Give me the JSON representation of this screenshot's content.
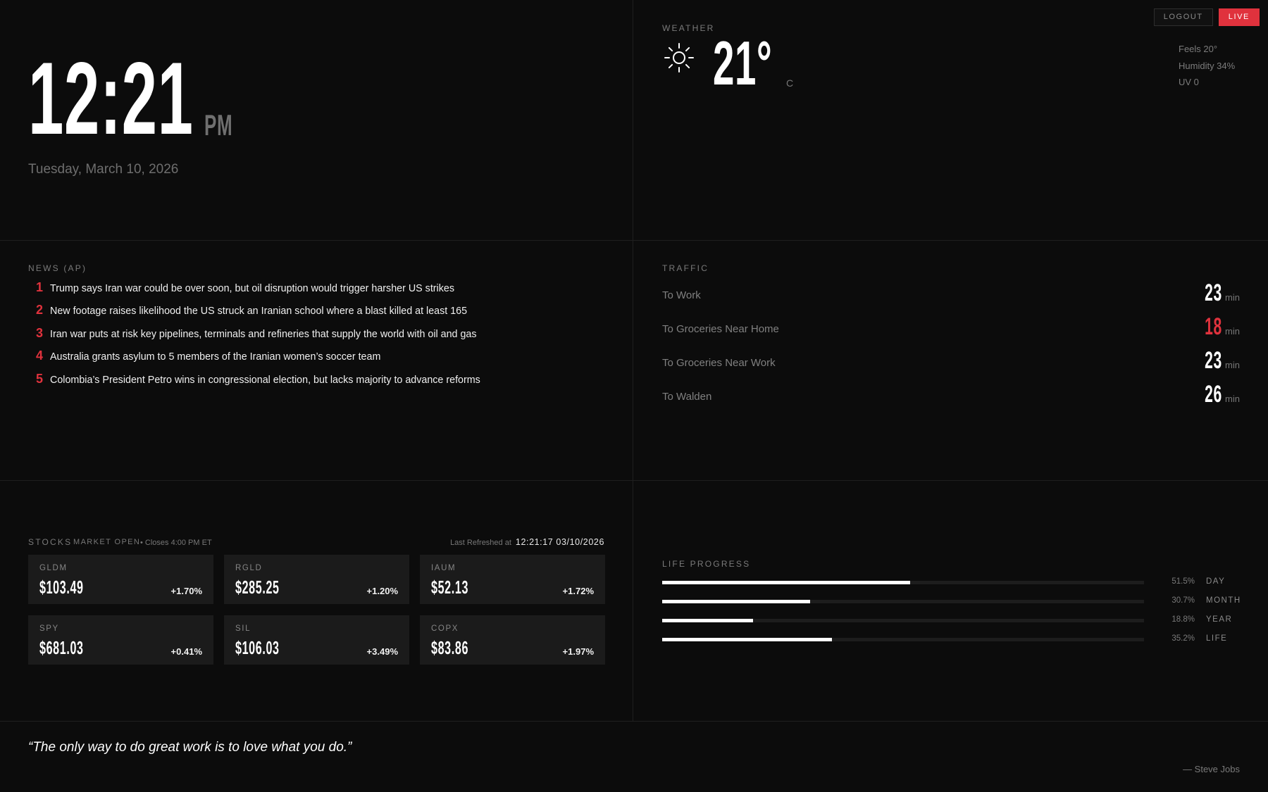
{
  "controls": {
    "logout_label": "LOGOUT",
    "live_label": "LIVE"
  },
  "clock": {
    "time": "12:21",
    "ampm": "PM",
    "date": "Tuesday, March 10, 2026"
  },
  "weather": {
    "label": "WEATHER",
    "icon": "sun-icon",
    "temp": "21°",
    "unit": "C",
    "feels": "Feels 20°",
    "humidity": "Humidity 34%",
    "uv": "UV 0"
  },
  "news": {
    "label": "NEWS (AP)",
    "items": [
      {
        "num": "1",
        "text": "Trump says Iran war could be over soon, but oil disruption would trigger harsher US strikes"
      },
      {
        "num": "2",
        "text": "New footage raises likelihood the US struck an Iranian school where a blast killed at least 165"
      },
      {
        "num": "3",
        "text": "Iran war puts at risk key pipelines, terminals and refineries that supply the world with oil and gas"
      },
      {
        "num": "4",
        "text": "Australia grants asylum to 5 members of the Iranian women’s soccer team"
      },
      {
        "num": "5",
        "text": "Colombia’s President Petro wins in congressional election, but lacks majority to advance reforms"
      }
    ]
  },
  "traffic": {
    "label": "TRAFFIC",
    "unit": "min",
    "routes": [
      {
        "name": "To Work",
        "minutes": "23",
        "alert": false
      },
      {
        "name": "To Groceries Near Home",
        "minutes": "18",
        "alert": true
      },
      {
        "name": "To Groceries Near Work",
        "minutes": "23",
        "alert": false
      },
      {
        "name": "To Walden",
        "minutes": "26",
        "alert": false
      }
    ]
  },
  "stocks": {
    "label": "STOCKS",
    "market_status": "MARKET OPEN",
    "closes": "• Closes 4:00 PM ET",
    "refreshed_label": "Last Refreshed at",
    "refreshed_value": "12:21:17 03/10/2026",
    "items": [
      {
        "symbol": "GLDM",
        "price": "$103.49",
        "change": "+1.70%"
      },
      {
        "symbol": "RGLD",
        "price": "$285.25",
        "change": "+1.20%"
      },
      {
        "symbol": "IAUM",
        "price": "$52.13",
        "change": "+1.72%"
      },
      {
        "symbol": "SPY",
        "price": "$681.03",
        "change": "+0.41%"
      },
      {
        "symbol": "SIL",
        "price": "$106.03",
        "change": "+3.49%"
      },
      {
        "symbol": "COPX",
        "price": "$83.86",
        "change": "+1.97%"
      }
    ]
  },
  "life_progress": {
    "label": "LIFE PROGRESS",
    "items": [
      {
        "name": "DAY",
        "percent": 51.5,
        "percent_label": "51.5%"
      },
      {
        "name": "MONTH",
        "percent": 30.7,
        "percent_label": "30.7%"
      },
      {
        "name": "YEAR",
        "percent": 18.8,
        "percent_label": "18.8%"
      },
      {
        "name": "LIFE",
        "percent": 35.2,
        "percent_label": "35.2%"
      }
    ]
  },
  "quote": {
    "text": "“The only way to do great work is to love what you do.”",
    "author": "— Steve Jobs"
  },
  "colors": {
    "accent": "#e0323d",
    "background": "#0c0c0c",
    "card": "#1b1b1b"
  }
}
